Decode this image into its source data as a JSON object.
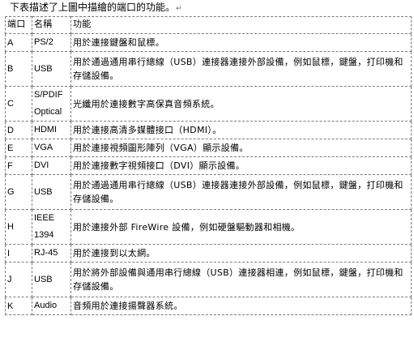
{
  "intro": "下表描述了上圖中描繪的端口的功能。",
  "paragraph_mark": "↵",
  "table": {
    "headers": {
      "port": "端口",
      "name": "名稱",
      "function": "功能"
    },
    "rows": [
      {
        "port": "A",
        "name": "PS/2",
        "function": "用於連接鍵盤和鼠標。"
      },
      {
        "port": "B",
        "name": "USB",
        "function": "用於通過通用串行總線（USB）連接器連接外部設備，例如鼠標，鍵盤，打印機和存儲設備。"
      },
      {
        "port": "C",
        "name": "S/PDIF Optical",
        "function": "光纖用於連接數字高保真音頻系統。"
      },
      {
        "port": "D",
        "name": "HDMI",
        "function": "用於連接高清多媒體接口（HDMI）。"
      },
      {
        "port": "E",
        "name": "VGA",
        "function": "用於連接視頻圖形陣列（VGA）顯示設備。"
      },
      {
        "port": "F",
        "name": "DVI",
        "function": "用於連接數字視頻接口（DVI）顯示設備。"
      },
      {
        "port": "G",
        "name": "USB",
        "function": "用於通過通用串行總線（USB）連接器連接外部設備，例如鼠標，鍵盤，打印機和存儲設備。"
      },
      {
        "port": "H",
        "name": "IEEE 1394",
        "function": "用於連接外部 FireWire 設備，例如硬盤驅動器和相機。"
      },
      {
        "port": "I",
        "name": "RJ-45",
        "function": "用於連接到以太網。"
      },
      {
        "port": "J",
        "name": "USB",
        "function": "用於將外部設備與通用串行總線（USB）連接器相連，例如鼠標，鍵盤，打印機和存儲設備。"
      },
      {
        "port": "K",
        "name": "Audio",
        "function": "音頻用於連接揚聲器系統。"
      }
    ]
  }
}
